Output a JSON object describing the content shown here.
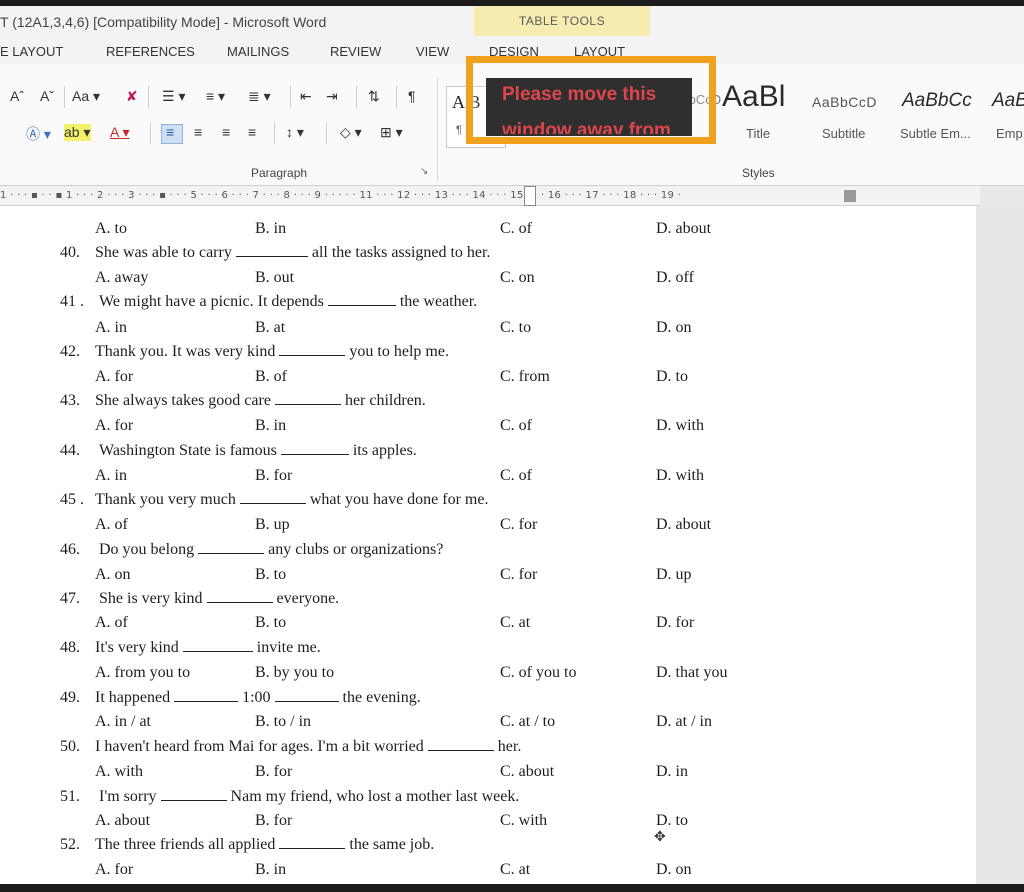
{
  "window": {
    "title": "T (12A1,3,4,6) [Compatibility Mode] - Microsoft Word",
    "contextual_group": "TABLE TOOLS"
  },
  "ribbon_tabs": [
    {
      "label": "E LAYOUT"
    },
    {
      "label": "REFERENCES"
    },
    {
      "label": "MAILINGS"
    },
    {
      "label": "REVIEW"
    },
    {
      "label": "VIEW"
    },
    {
      "label": "DESIGN"
    },
    {
      "label": "LAYOUT"
    }
  ],
  "ribbon": {
    "font_grow": "Aˆ",
    "font_shrink": "Aˇ",
    "change_case": "Aa ▾",
    "clear_format": "✘",
    "bullets": "☰ ▾",
    "numbering": "≡ ▾",
    "multilevel": "≣ ▾",
    "decrease_indent": "⇤",
    "increase_indent": "⇥",
    "sort": "⇅",
    "show_marks": "¶",
    "text_effects": "Ⓐ ▾",
    "highlight": "ab ▾",
    "font_color": "A ▾",
    "align_left": "≡",
    "align_center": "≡",
    "align_right": "≡",
    "justify": "≡",
    "line_spacing": "↕ ▾",
    "shading": "◇ ▾",
    "borders": "⊞ ▾",
    "paragraph_group_label": "Paragraph",
    "styles_group_label": "Styles",
    "dialog_launcher": "↘"
  },
  "styles": [
    {
      "preview": "A B",
      "name": "¶"
    },
    {
      "preview": "AaBbCcD",
      "name": ""
    },
    {
      "preview": "AaBl",
      "name": "Title"
    },
    {
      "preview": "AaBbCcD",
      "name": "Subtitle"
    },
    {
      "preview": "AaBbCc",
      "name": "Subtle Em..."
    },
    {
      "preview": "AaB",
      "name": "Emp"
    }
  ],
  "overlay": {
    "line1": "Please move this",
    "line2": "window away from"
  },
  "ruler": {
    "text": "1 · · · ▪ · · ▪ 1 · · · 2 · · · 3 · · · ▪ · · · 5 · · · 6 · · · 7 · · · 8 · · · 9 · · · · · 11 · · · 12 · · · 13 · · · 14 · · · 15 · · · 16 · · · 17 · · · 18 · · · 19 ·"
  },
  "document": {
    "first_options": [
      "A. to",
      "B. in",
      "C. of",
      "D. about"
    ],
    "questions": [
      {
        "number": "40.",
        "before": "She was able to carry",
        "after": "all the tasks assigned to her.",
        "options": [
          "A. away",
          "B. out",
          "C. on",
          "D. off"
        ]
      },
      {
        "number": "41 .",
        "before": "We might have a picnic. It depends",
        "after": "the weather.",
        "options": [
          "A. in",
          "B. at",
          "C. to",
          "D. on"
        ]
      },
      {
        "number": "42.",
        "before": "Thank you. It was very kind",
        "after": "you to help me.",
        "options": [
          "A. for",
          "B. of",
          "C. from",
          "D. to"
        ]
      },
      {
        "number": "43.",
        "before": "She always takes good care",
        "after": "her children.",
        "options": [
          "A. for",
          "B. in",
          "C. of",
          "D. with"
        ]
      },
      {
        "number": "44.",
        "before": "Washington State is famous",
        "after": "its apples.",
        "options": [
          "A. in",
          "B. for",
          "C. of",
          "D. with"
        ]
      },
      {
        "number": "45 .",
        "before": "Thank you very much",
        "after": "what you have done for me.",
        "options": [
          "A. of",
          "B. up",
          "C. for",
          "D. about"
        ]
      },
      {
        "number": "46.",
        "before": "Do you belong",
        "after": "any clubs or organizations?",
        "options": [
          "A. on",
          "B. to",
          "C. for",
          "D. up"
        ]
      },
      {
        "number": "47.",
        "before": "She is very kind",
        "after": "everyone.",
        "options": [
          "A. of",
          "B. to",
          "C. at",
          "D. for"
        ]
      },
      {
        "number": "48.",
        "before": "It's very kind",
        "after": "invite me.",
        "options": [
          "A. from you to",
          "B. by you to",
          "C. of you to",
          "D. that you"
        ]
      },
      {
        "number": "49.",
        "before": "It happened",
        "middle": "1:00",
        "after": "the evening.",
        "options": [
          "A. in / at",
          "B. to / in",
          "C. at / to",
          "D. at / in"
        ]
      },
      {
        "number": "50.",
        "before": "I haven't heard from Mai for ages. I'm a bit worried",
        "after": "her.",
        "options": [
          "A. with",
          "B. for",
          "C. about",
          "D. in"
        ]
      },
      {
        "number": "51.",
        "before": "I'm sorry",
        "after": "Nam my friend, who lost a mother last week.",
        "options": [
          "A. about",
          "B. for",
          "C. with",
          "D. to"
        ]
      },
      {
        "number": "52.",
        "before": "The three friends all applied",
        "after": "the same job.",
        "options": [
          "A. for",
          "B. in",
          "C. at",
          "D. on"
        ]
      }
    ]
  }
}
